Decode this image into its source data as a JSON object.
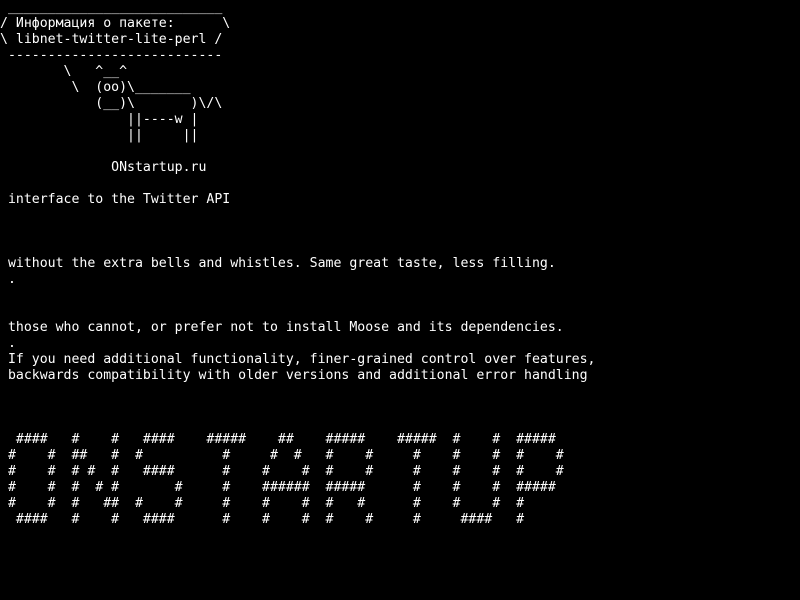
{
  "terminal": {
    "foreground": "#ffffff",
    "background": "#000000",
    "lines": [
      " ___________________________",
      "/ Информация о пакете:      \\",
      "\\ libnet-twitter-lite-perl /",
      " ---------------------------",
      "        \\   ^__^",
      "         \\  (oo)\\_______",
      "            (__)\\       )\\/\\",
      "                ||----w |",
      "                ||     ||",
      "",
      "              ONstartup.ru",
      "",
      " interface to the Twitter API",
      "",
      "",
      "",
      " without the extra bells and whistles. Same great taste, less filling.",
      " .",
      "",
      "",
      " those who cannot, or prefer not to install Moose and its dependencies.",
      " .",
      " If you need additional functionality, finer-grained control over features,",
      " backwards compatibility with older versions and additional error handling",
      "",
      "",
      "",
      "  ####   #    #   ####    #####    ##    #####    #####  #    #  #####",
      " #    #  ##   #  #          #     #  #   #    #     #    #    #  #    #",
      " #    #  # #  #   ####      #    #    #  #    #     #    #    #  #    #",
      " #    #  #  # #       #     #    ######  #####      #    #    #  #####",
      " #    #  #   ##  #    #     #    #    #  #   #      #    #    #  #",
      "  ####   #    #   ####      #    #    #  #    #     #     ####   #"
    ]
  }
}
